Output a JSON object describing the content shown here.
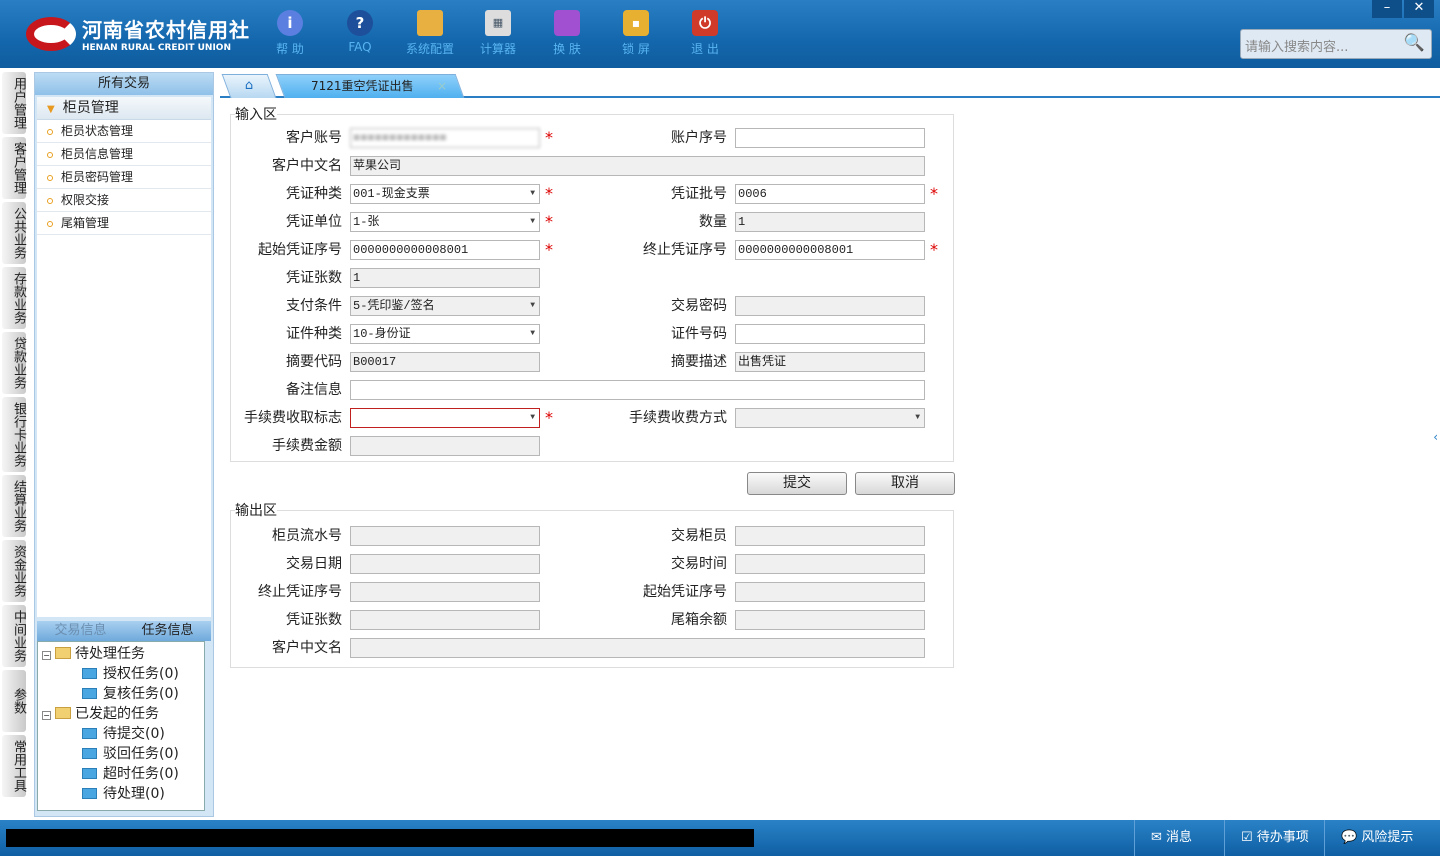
{
  "header": {
    "logo_cn": "河南省农村信用社",
    "logo_en": "HENAN RURAL CREDIT UNION",
    "tools": [
      {
        "icon": "info-icon",
        "label": "帮 助"
      },
      {
        "icon": "question-icon",
        "label": "FAQ"
      },
      {
        "icon": "toolbox-icon",
        "label": "系统配置"
      },
      {
        "icon": "calculator-icon",
        "label": "计算器"
      },
      {
        "icon": "shirt-icon",
        "label": "换 肤"
      },
      {
        "icon": "lock-icon",
        "label": "锁 屏"
      },
      {
        "icon": "power-icon",
        "label": "退 出"
      }
    ],
    "search_placeholder": "请输入搜索内容..."
  },
  "vtabs": [
    "用户管理",
    "客户管理",
    "公共业务",
    "存款业务",
    "贷款业务",
    "银行卡业务",
    "结算业务",
    "资金业务",
    "中间业务",
    "参数",
    "常用工具"
  ],
  "sidebar": {
    "title": "所有交易",
    "group": "柜员管理",
    "items": [
      "柜员状态管理",
      "柜员信息管理",
      "柜员密码管理",
      "权限交接",
      "尾箱管理"
    ],
    "task_tabs": [
      "交易信息",
      "任务信息"
    ],
    "tree": {
      "pending": "待处理任务",
      "pending_items": [
        "授权任务(0)",
        "复核任务(0)"
      ],
      "initiated": "已发起的任务",
      "initiated_items": [
        "待提交(0)",
        "驳回任务(0)",
        "超时任务(0)",
        "待处理(0)"
      ]
    }
  },
  "tabs": {
    "active": "7121重空凭证出售",
    "close": "×"
  },
  "input_area": {
    "legend": "输入区",
    "fields": {
      "acct": {
        "label": "客户账号",
        "value": "■■■■■■■■■■■■■"
      },
      "acct_seq": {
        "label": "账户序号",
        "value": ""
      },
      "cust_name": {
        "label": "客户中文名",
        "value": "苹果公司"
      },
      "voucher_type": {
        "label": "凭证种类",
        "value": "001-现金支票"
      },
      "voucher_batch": {
        "label": "凭证批号",
        "value": "0006"
      },
      "voucher_unit": {
        "label": "凭证单位",
        "value": "1-张"
      },
      "qty": {
        "label": "数量",
        "value": "1"
      },
      "start_no": {
        "label": "起始凭证序号",
        "value": "0000000000008001"
      },
      "end_no": {
        "label": "终止凭证序号",
        "value": "0000000000008001"
      },
      "count": {
        "label": "凭证张数",
        "value": "1"
      },
      "pay_cond": {
        "label": "支付条件",
        "value": "5-凭印鉴/签名"
      },
      "tx_pwd": {
        "label": "交易密码",
        "value": ""
      },
      "id_type": {
        "label": "证件种类",
        "value": "10-身份证"
      },
      "id_no": {
        "label": "证件号码",
        "value": ""
      },
      "abs_code": {
        "label": "摘要代码",
        "value": "B00017"
      },
      "abs_desc": {
        "label": "摘要描述",
        "value": "出售凭证"
      },
      "remark": {
        "label": "备注信息",
        "value": ""
      },
      "fee_flag": {
        "label": "手续费收取标志",
        "value": ""
      },
      "fee_method": {
        "label": "手续费收费方式",
        "value": ""
      },
      "fee_amt": {
        "label": "手续费金额",
        "value": ""
      }
    },
    "required_mark": "*",
    "submit": "提交",
    "cancel": "取消"
  },
  "output_area": {
    "legend": "输出区",
    "labels": [
      "柜员流水号",
      "交易柜员",
      "交易日期",
      "交易时间",
      "终止凭证序号",
      "起始凭证序号",
      "凭证张数",
      "尾箱余额",
      "客户中文名"
    ]
  },
  "status": {
    "message": "消息",
    "todo": "待办事项",
    "risk": "风险提示"
  }
}
